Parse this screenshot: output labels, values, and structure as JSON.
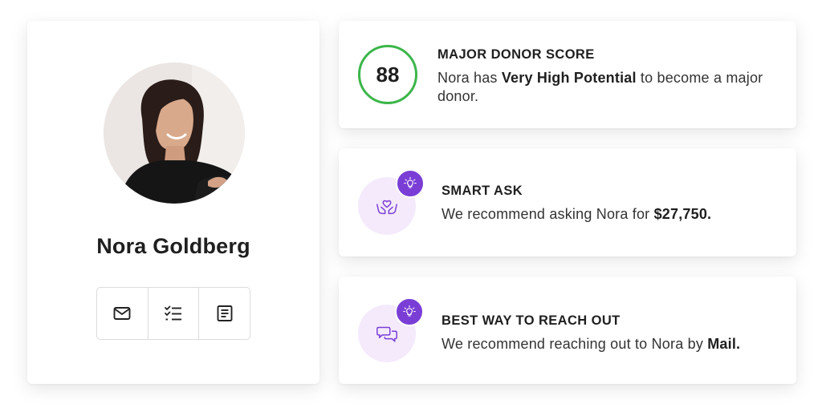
{
  "profile": {
    "name": "Nora Goldberg",
    "avatar_alt": "profile photo",
    "actions": [
      {
        "icon": "mail-icon"
      },
      {
        "icon": "checklist-icon"
      },
      {
        "icon": "notes-icon"
      }
    ]
  },
  "score_card": {
    "score": "88",
    "title": "MAJOR DONOR SCORE",
    "body_prefix": "Nora has ",
    "body_strong": "Very High Potential",
    "body_suffix": " to become a major donor.",
    "ring_color": "#3cb64a"
  },
  "smart_ask": {
    "title": "SMART ASK",
    "body_prefix": "We recommend asking Nora for ",
    "body_strong": "$27,750.",
    "icon": "hands-heart-icon"
  },
  "reach_out": {
    "title": "BEST WAY TO REACH OUT",
    "body_prefix": "We recommend reaching out to Nora by ",
    "body_strong": "Mail.",
    "icon": "chat-bubbles-icon"
  },
  "colors": {
    "accent_purple": "#7a3ed6",
    "bubble_bg": "#f4eafc",
    "score_green": "#3cb64a"
  }
}
